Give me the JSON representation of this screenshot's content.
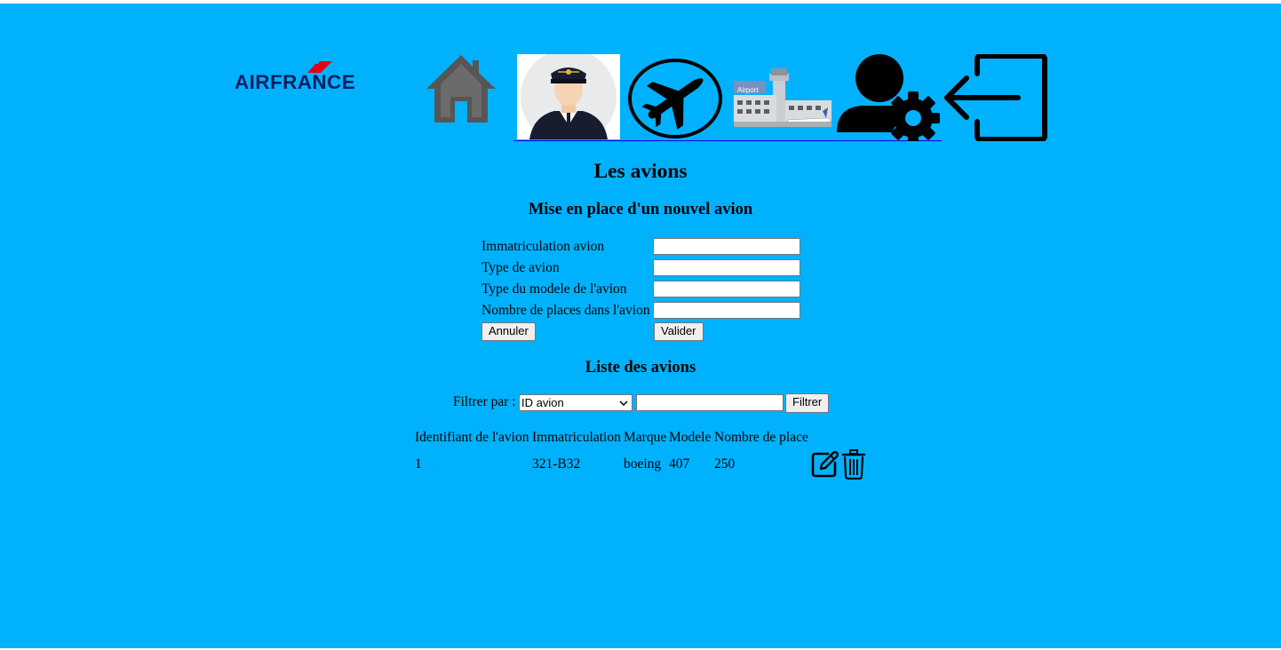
{
  "nav": {
    "logo_text": "AIRFRANCE",
    "items": [
      {
        "name": "home",
        "icon": "home-icon"
      },
      {
        "name": "pilot",
        "icon": "pilot-icon"
      },
      {
        "name": "plane",
        "icon": "airplane-icon"
      },
      {
        "name": "airport",
        "icon": "airport-icon",
        "sign_text": "Airport"
      },
      {
        "name": "user-settings",
        "icon": "user-settings-icon"
      },
      {
        "name": "logout",
        "icon": "logout-icon"
      }
    ]
  },
  "page": {
    "title": "Les avions",
    "form_heading": "Mise en place d'un nouvel avion",
    "list_heading": "Liste des avions"
  },
  "form": {
    "fields": [
      {
        "label": "Immatriculation avion",
        "value": ""
      },
      {
        "label": "Type de avion",
        "value": ""
      },
      {
        "label": "Type du modele de l'avion",
        "value": ""
      },
      {
        "label": "Nombre de places dans l'avion",
        "value": ""
      }
    ],
    "cancel_label": "Annuler",
    "submit_label": "Valider"
  },
  "filter": {
    "label": "Filtrer par :",
    "selected": "ID avion",
    "value": "",
    "button_label": "Filtrer"
  },
  "table": {
    "headers": [
      "Identifiant de l'avion",
      "Immatriculation",
      "Marque",
      "Modele",
      "Nombre de place"
    ],
    "rows": [
      [
        "1",
        "321-B32",
        "boeing",
        "407",
        "250"
      ]
    ]
  },
  "colors": {
    "background": "#00b2fe",
    "logo_blue": "#051f5e",
    "logo_red": "#e1001a"
  }
}
